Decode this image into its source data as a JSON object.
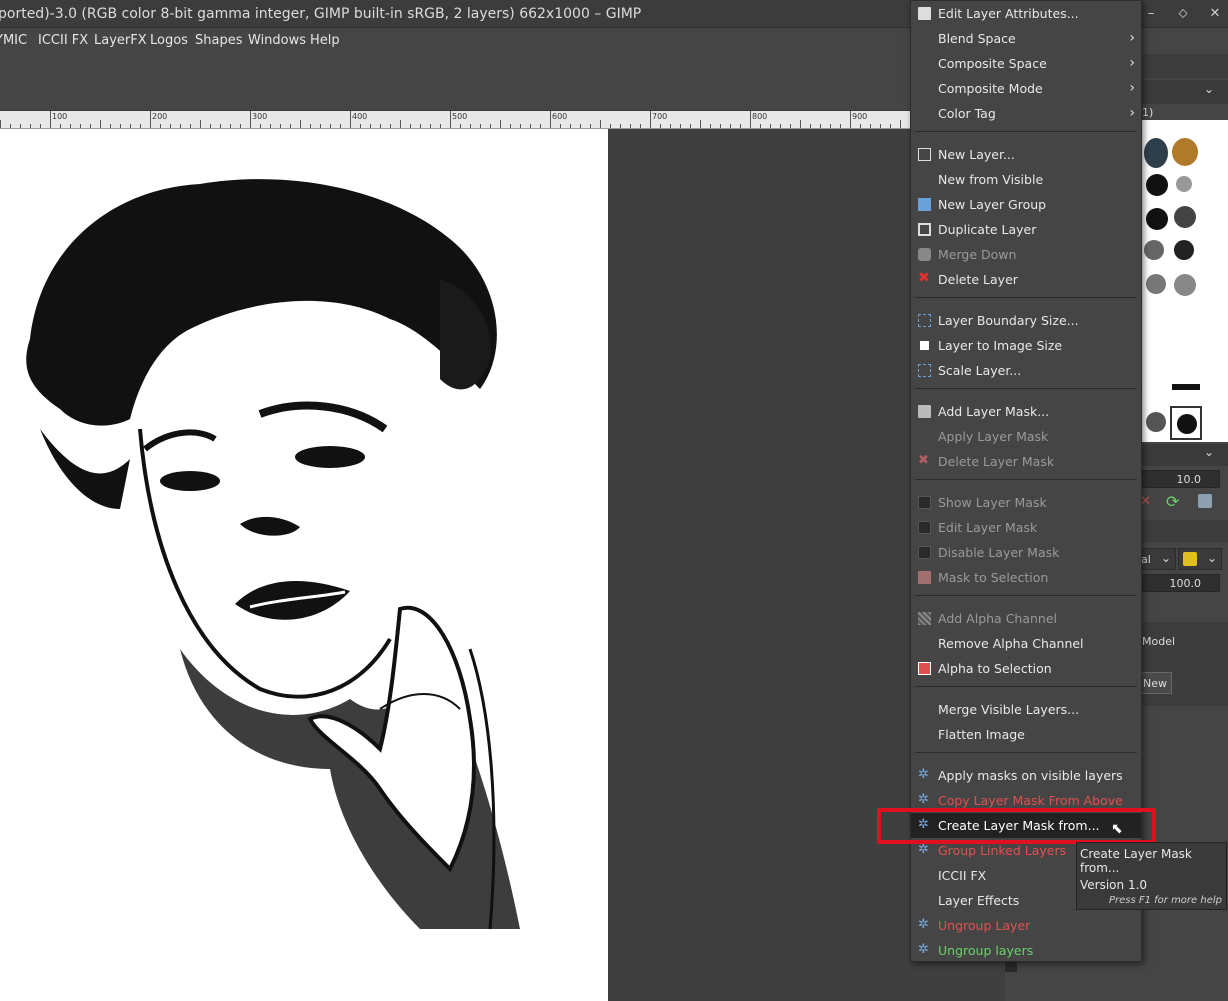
{
  "window": {
    "title": "ported)-3.0 (RGB color 8-bit gamma integer, GIMP built-in sRGB, 2 layers) 662x1000 – GIMP",
    "minimize": "–",
    "maximize": "⬦",
    "close": "✕"
  },
  "menubar": [
    "YMIC",
    "ICCII FX",
    "LayerFX",
    "Logos",
    "Shapes",
    "Windows",
    "Help"
  ],
  "ruler_labels": [
    "100",
    "200",
    "300",
    "400",
    "500",
    "600",
    "700",
    "800",
    "900"
  ],
  "context_menu": {
    "items": [
      {
        "label": "Edit Layer Attributes...",
        "icon": "edit-icon",
        "state": "normal"
      },
      {
        "label": "Blend Space",
        "submenu": true,
        "state": "normal"
      },
      {
        "label": "Composite Space",
        "submenu": true,
        "state": "normal"
      },
      {
        "label": "Composite Mode",
        "submenu": true,
        "state": "normal"
      },
      {
        "label": "Color Tag",
        "submenu": true,
        "state": "normal"
      },
      {
        "label": "New Layer...",
        "icon": "new-layer-icon",
        "state": "normal"
      },
      {
        "label": "New from Visible",
        "state": "normal"
      },
      {
        "label": "New Layer Group",
        "icon": "folder-icon",
        "state": "normal"
      },
      {
        "label": "Duplicate Layer",
        "icon": "duplicate-icon",
        "state": "normal"
      },
      {
        "label": "Merge Down",
        "icon": "merge-icon",
        "state": "disabled"
      },
      {
        "label": "Delete Layer",
        "icon": "delete-icon",
        "state": "normal"
      },
      {
        "label": "Layer Boundary Size...",
        "icon": "boundary-icon",
        "state": "normal"
      },
      {
        "label": "Layer to Image Size",
        "icon": "image-size-icon",
        "state": "normal"
      },
      {
        "label": "Scale Layer...",
        "icon": "scale-icon",
        "state": "normal"
      },
      {
        "label": "Add Layer Mask...",
        "icon": "add-mask-icon",
        "state": "normal"
      },
      {
        "label": "Apply Layer Mask",
        "state": "disabled"
      },
      {
        "label": "Delete Layer Mask",
        "icon": "delete-mask-icon",
        "state": "disabled"
      },
      {
        "label": "Show Layer Mask",
        "icon": "checkbox-icon",
        "state": "disabled"
      },
      {
        "label": "Edit Layer Mask",
        "icon": "checkbox-icon",
        "state": "disabled"
      },
      {
        "label": "Disable Layer Mask",
        "icon": "checkbox-icon",
        "state": "disabled"
      },
      {
        "label": "Mask to Selection",
        "icon": "mask-selection-icon",
        "state": "disabled"
      },
      {
        "label": "Add Alpha Channel",
        "icon": "alpha-icon",
        "state": "disabled"
      },
      {
        "label": "Remove Alpha Channel",
        "state": "normal"
      },
      {
        "label": "Alpha to Selection",
        "icon": "alpha-selection-icon",
        "state": "normal"
      },
      {
        "label": "Merge Visible Layers...",
        "state": "normal"
      },
      {
        "label": "Flatten Image",
        "state": "normal"
      },
      {
        "label": "Apply masks on visible layers",
        "icon": "script-icon",
        "state": "normal"
      },
      {
        "label": "Copy Layer Mask From Above",
        "icon": "script-icon",
        "state": "red"
      },
      {
        "label": "Create Layer Mask from...",
        "icon": "script-icon",
        "state": "highlighted"
      },
      {
        "label": "Group Linked Layers",
        "icon": "script-icon",
        "state": "red"
      },
      {
        "label": "ICCII FX",
        "state": "normal"
      },
      {
        "label": "Layer Effects",
        "state": "normal"
      },
      {
        "label": "Ungroup Layer",
        "icon": "script-icon",
        "state": "red"
      },
      {
        "label": "Ungroup layers",
        "icon": "script-icon",
        "state": "green"
      }
    ]
  },
  "tooltip": {
    "title": "Create Layer Mask from...",
    "version": "Version 1.0",
    "hint": "Press F1 for more help"
  },
  "dock": {
    "brush_size": "10.0",
    "opacity": "100.0",
    "mode_partial": "al",
    "model_label": "Model",
    "new_label": "New",
    "brush_tab_partial": "1)"
  },
  "colors": {
    "highlight_box": "#e01020",
    "menu_bg": "#454545",
    "disabled_text": "#9a9a9a",
    "red_text": "#e05050",
    "green_text": "#6ad06a"
  }
}
